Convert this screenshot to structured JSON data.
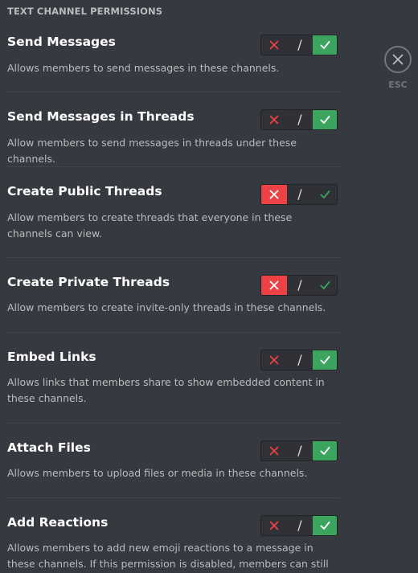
{
  "header": {
    "title": "TEXT CHANNEL PERMISSIONS"
  },
  "close": {
    "label": "ESC",
    "icon": "close-icon"
  },
  "colors": {
    "deny_active": "#ed4245",
    "allow_active": "#3ba55d",
    "background": "#36393f"
  },
  "permissions": [
    {
      "title": "Send Messages",
      "description": "Allows members to send messages in these channels.",
      "state": "allow",
      "pass_label": "/"
    },
    {
      "title": "Send Messages in Threads",
      "description": "Allow members to send messages in threads under these channels.",
      "state": "allow",
      "pass_label": "/"
    },
    {
      "title": "Create Public Threads",
      "description": "Allow members to create threads that everyone in these channels can view.",
      "state": "deny",
      "pass_label": "/"
    },
    {
      "title": "Create Private Threads",
      "description": "Allow members to create invite-only threads in these channels.",
      "state": "deny",
      "pass_label": "/"
    },
    {
      "title": "Embed Links",
      "description": "Allows links that members share to show embedded content in these channels.",
      "state": "allow",
      "pass_label": "/"
    },
    {
      "title": "Attach Files",
      "description": "Allows members to upload files or media in these channels.",
      "state": "allow",
      "pass_label": "/"
    },
    {
      "title": "Add Reactions",
      "description": "Allows members to add new emoji reactions to a message in these channels. If this permission is disabled, members can still react using",
      "state": "allow",
      "pass_label": "/"
    }
  ]
}
